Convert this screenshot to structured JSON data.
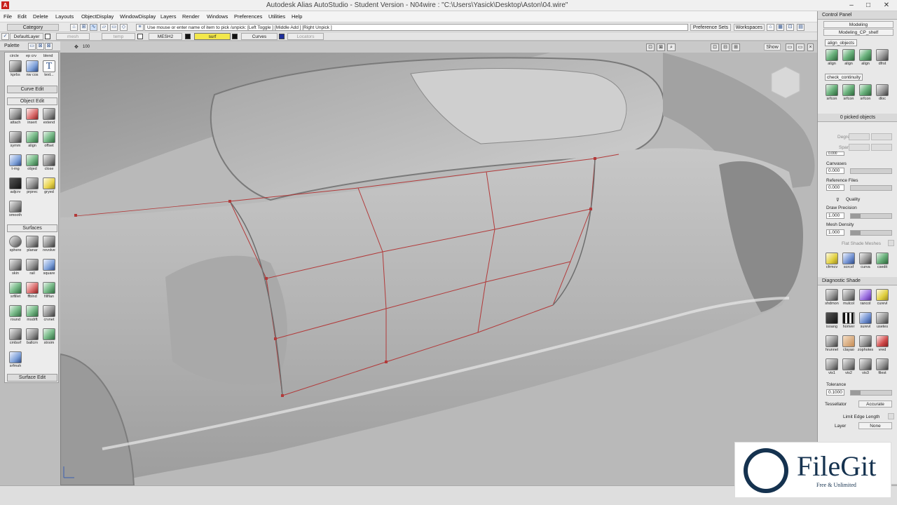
{
  "window": {
    "title": "Autodesk Alias AutoStudio        - Student Version    - N04wire : \"C:\\Users\\Yasick\\Desktop\\Aston\\04.wire\"",
    "min": "–",
    "max": "□",
    "close": "✕"
  },
  "menu": [
    "File",
    "Edit",
    "Delete",
    "Layouts",
    "ObjectDisplay",
    "WindowDisplay",
    "Layers",
    "Render",
    "Windows",
    "Preferences",
    "Utilities",
    "Help"
  ],
  "toolbar": {
    "category": "Category",
    "prompt": "Use mouse or enter name of item to pick /unpick: [Left Toggle ] [Middle Add ] [Right Unpick ]",
    "preference_sets": "Preference Sets",
    "workspaces": "Workspaces"
  },
  "layers": {
    "default": "DefaultLayer",
    "mesh": "mesh",
    "temp": "temp",
    "mesh2": "MESH2",
    "surf": "surf",
    "curves": "Curves",
    "locators": "Locators"
  },
  "palette": {
    "header": "Palette",
    "zoom": "100",
    "top_labels": [
      "circle",
      "ep crv",
      "blend"
    ],
    "curve_tools": [
      {
        "label": "kprbs",
        "icon": "curve-pen-icon"
      },
      {
        "label": "nw cos",
        "icon": "curve-on-surface-icon"
      },
      {
        "label": "text...",
        "icon": "text-icon"
      }
    ],
    "curve_edit": "Curve Edit",
    "object_edit": "Object Edit",
    "object_tools": [
      {
        "label": "attach",
        "icon": "attach-icon"
      },
      {
        "label": "insert",
        "icon": "insert-icon"
      },
      {
        "label": "extend",
        "icon": "extend-icon"
      },
      {
        "label": "symm",
        "icon": "symmetry-icon"
      },
      {
        "label": "align",
        "icon": "align-icon"
      },
      {
        "label": "offset",
        "icon": "offset-icon"
      },
      {
        "label": "t-rng",
        "icon": "trim-range-icon"
      },
      {
        "label": "objed",
        "icon": "object-edit-icon"
      },
      {
        "label": "close",
        "icon": "close-surface-icon"
      },
      {
        "label": "adjcrv",
        "icon": "adjust-curve-icon"
      },
      {
        "label": "prprec",
        "icon": "precision-icon"
      },
      {
        "label": "gryed",
        "icon": "geometry-edit-icon"
      },
      {
        "label": "smooth",
        "icon": "smooth-icon"
      }
    ],
    "surfaces": "Surfaces",
    "surface_tools": [
      {
        "label": "sphere",
        "icon": "sphere-icon"
      },
      {
        "label": "planar",
        "icon": "planar-icon"
      },
      {
        "label": "revolve",
        "icon": "revolve-icon"
      },
      {
        "label": "skin",
        "icon": "skin-icon"
      },
      {
        "label": "rail",
        "icon": "rail-icon"
      },
      {
        "label": "square",
        "icon": "square-surface-icon"
      },
      {
        "label": "srfillet",
        "icon": "surface-fillet-icon"
      },
      {
        "label": "ffblnd",
        "icon": "freeform-blend-icon"
      },
      {
        "label": "fillflan",
        "icon": "fillet-flange-icon"
      },
      {
        "label": "round",
        "icon": "round-icon"
      },
      {
        "label": "msdrft",
        "icon": "multi-draft-icon"
      },
      {
        "label": "crvnet",
        "icon": "curve-network-icon"
      },
      {
        "label": "cmbsrf",
        "icon": "combine-surface-icon"
      },
      {
        "label": "ballcrn",
        "icon": "ball-corner-icon"
      },
      {
        "label": "strsim",
        "icon": "stretch-sim-icon"
      },
      {
        "label": "srfmsh",
        "icon": "surface-mesh-icon"
      }
    ],
    "surface_edit": "Surface Edit"
  },
  "viewport": {
    "show_button": "Show"
  },
  "control_panel": {
    "header": "Control Panel",
    "mode": "Modeling",
    "shelf": "Modeling_CP_shelf",
    "tab_align": "align_objects",
    "align_tools": [
      {
        "label": "align",
        "icon": "align-tool-icon"
      },
      {
        "label": "align",
        "icon": "align-tool-icon"
      },
      {
        "label": "align",
        "icon": "align-tool-icon"
      },
      {
        "label": "dfrst",
        "icon": "deform-icon"
      }
    ],
    "tab_check": "check_continuity",
    "check_tools": [
      {
        "label": "srfcon",
        "icon": "surface-continuity-icon"
      },
      {
        "label": "srfcon",
        "icon": "surface-continuity-icon"
      },
      {
        "label": "srfcon",
        "icon": "surface-continuity-icon"
      },
      {
        "label": "dloc",
        "icon": "locator-icon"
      }
    ],
    "picked": "0 picked objects",
    "degree_label": "Degree",
    "spans_label": "Spans",
    "partial_value": "0.000",
    "canvases_label": "Canvases",
    "canvases_value": "0.000",
    "reffiles_label": "Reference Files",
    "reffiles_value": "0.000",
    "quality_label": "Quality",
    "draw_precision_label": "Draw Precision",
    "draw_precision_value": "1.000",
    "mesh_density_label": "Mesh Density",
    "mesh_density_value": "1.000",
    "flat_shade_label": "Flat Shade Meshes",
    "shelf_tools": [
      {
        "label": "cfrmcv",
        "icon": "conform-curve-icon"
      },
      {
        "label": "scrcsf",
        "icon": "scratch-surface-icon"
      },
      {
        "label": "curva",
        "icon": "curvature-icon"
      },
      {
        "label": "csedit",
        "icon": "cv-edit-icon"
      }
    ]
  },
  "diagnostic": {
    "header": "Diagnostic Shade",
    "tools": [
      {
        "label": "shdmon",
        "icon": "shade-monitor-icon"
      },
      {
        "label": "mulcol",
        "icon": "multi-color-icon"
      },
      {
        "label": "rancol",
        "icon": "random-color-icon"
      },
      {
        "label": "curevl",
        "icon": "curvature-eval-icon"
      },
      {
        "label": "isoang",
        "icon": "isoangle-icon"
      },
      {
        "label": "horiver",
        "icon": "horizontal-vertical-icon"
      },
      {
        "label": "surevl",
        "icon": "surface-eval-icon"
      },
      {
        "label": "usetes",
        "icon": "tessellate-icon"
      },
      {
        "label": "hrunnel",
        "icon": "highlight-icon"
      },
      {
        "label": "clayao",
        "icon": "clay-icon"
      },
      {
        "label": "zophotes",
        "icon": "zebra-photo-icon"
      },
      {
        "label": "vred",
        "icon": "vred-icon"
      },
      {
        "label": "vis1",
        "icon": "visual-1-icon"
      },
      {
        "label": "vis2",
        "icon": "visual-2-icon"
      },
      {
        "label": "vis3",
        "icon": "visual-3-icon"
      },
      {
        "label": "filest",
        "icon": "file-state-icon"
      }
    ],
    "tolerance_label": "Tolerance",
    "tolerance_value": "0.1000",
    "tessellator_label": "Tessellator",
    "tessellator_value": "Accurate",
    "limit_edge_label": "Limit Edge Length",
    "layer_label": "Layer",
    "layer_value": "None"
  },
  "watermark": {
    "name": "FileGit",
    "tagline": "Free & Unlimited"
  },
  "colors": {
    "accent_yellow": "#f3e84b",
    "curve_red": "#b23a3a",
    "brand_navy": "#15324f"
  }
}
